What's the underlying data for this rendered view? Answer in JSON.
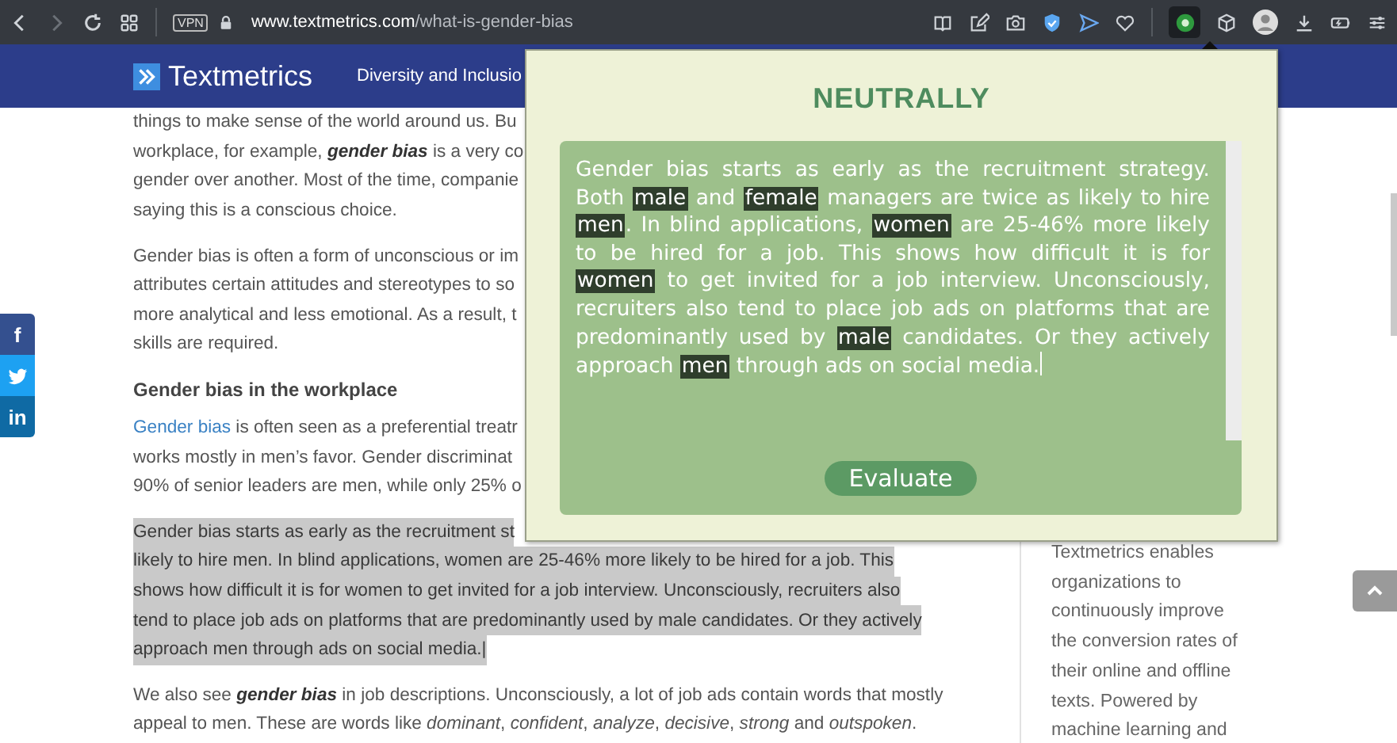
{
  "browser": {
    "nav": [
      {
        "kind": "back",
        "disabled": false
      },
      {
        "kind": "forward",
        "disabled": true
      },
      {
        "kind": "reload",
        "disabled": false
      },
      {
        "kind": "tabs",
        "disabled": false
      }
    ],
    "vpn_badge": "VPN",
    "url_host": "www.textmetrics.com",
    "url_path": "/what-is-gender-bias",
    "tools": [
      {
        "kind": "reader"
      },
      {
        "kind": "edit"
      },
      {
        "kind": "camera"
      },
      {
        "kind": "shield"
      },
      {
        "kind": "send"
      },
      {
        "kind": "heart"
      }
    ],
    "extension": {
      "active": true
    },
    "tools_right": [
      {
        "kind": "cube"
      },
      {
        "kind": "avatar"
      },
      {
        "kind": "download"
      },
      {
        "kind": "battery"
      },
      {
        "kind": "settings"
      }
    ]
  },
  "site_header": {
    "logo_text": "Textmetrics",
    "nav_item": "Diversity and Inclusio"
  },
  "share": [
    {
      "kind": "facebook",
      "label": "f"
    },
    {
      "kind": "twitter"
    },
    {
      "kind": "linkedin",
      "label": "in"
    }
  ],
  "article": [
    {
      "kind": "paragraph",
      "highlighted": false,
      "lines": [
        {
          "text": "things to make sense of the world around us. Bu"
        },
        {
          "text": "workplace, for example, **gender bias** is a very co"
        },
        {
          "text": "gender over another. Most of the time, companie"
        },
        {
          "text": "saying this is a conscious choice."
        }
      ]
    },
    {
      "kind": "paragraph",
      "highlighted": false,
      "lines": [
        {
          "text": "Gender bias is often a form of unconscious or im"
        },
        {
          "text": "attributes certain attitudes and stereotypes to so"
        },
        {
          "text": "more analytical and less emotional. As a result, t"
        },
        {
          "text": "skills are required."
        }
      ]
    },
    {
      "kind": "heading",
      "text": "Gender bias in the workplace"
    },
    {
      "kind": "paragraph",
      "highlighted": false,
      "lines": [
        {
          "link": "Gender bias",
          "text": " is often seen as a preferential treatr"
        },
        {
          "text": "works mostly in men’s favor. Gender discriminat"
        },
        {
          "text": "90% of senior leaders are men, while only 25% o"
        }
      ]
    },
    {
      "kind": "paragraph",
      "highlighted": true,
      "lines": [
        {
          "text": "Gender bias starts as early as the recruitment st"
        },
        {
          "text": "likely to hire men. In blind applications, women are 25-46% more likely to be hired for a job. This"
        },
        {
          "text": "shows how difficult it is for women to get invited for a job interview. Unconsciously, recruiters also"
        },
        {
          "text": "tend to place job ads on platforms that are predominantly used by male candidates. Or they actively"
        },
        {
          "text": "approach men through ads on social media.|"
        }
      ]
    },
    {
      "kind": "paragraph",
      "highlighted": false,
      "lines": [
        {
          "text": "We also see **gender bias** in job descriptions. Unconsciously, a lot of job ads contain words that mostly"
        },
        {
          "text": "appeal to men. These are words like *dominant*, *confident*, *analyze*, *decisive*, *strong* and *outspoken*."
        }
      ]
    }
  ],
  "sidebar": [
    "Textmetrics enables",
    "organizations to",
    "continuously improve",
    "the conversion rates of",
    "their online and offline",
    "texts. Powered by",
    "machine learning and"
  ],
  "popup": {
    "title": "NEUTRALLY",
    "segments": [
      {
        "text": "Gender bias starts as early as the recruitment strategy. Both ",
        "flagged": false
      },
      {
        "text": "male",
        "flagged": true
      },
      {
        "text": " and ",
        "flagged": false
      },
      {
        "text": "female",
        "flagged": true
      },
      {
        "text": " managers are twice as likely to hire ",
        "flagged": false
      },
      {
        "text": "men",
        "flagged": true
      },
      {
        "text": ". In blind applications, ",
        "flagged": false
      },
      {
        "text": "women",
        "flagged": true
      },
      {
        "text": " are 25-46% more likely to be hired for a job. This shows how difficult it is for ",
        "flagged": false
      },
      {
        "text": "women",
        "flagged": true
      },
      {
        "text": " to get invited for a job interview. Unconsciously, recruiters also tend to place job ads on platforms that are predominantly used by ",
        "flagged": false
      },
      {
        "text": "male",
        "flagged": true
      },
      {
        "text": " candidates. Or they actively approach ",
        "flagged": false
      },
      {
        "text": "men",
        "flagged": true
      },
      {
        "text": " through ads on social media.",
        "flagged": false
      }
    ],
    "button": "Evaluate"
  }
}
